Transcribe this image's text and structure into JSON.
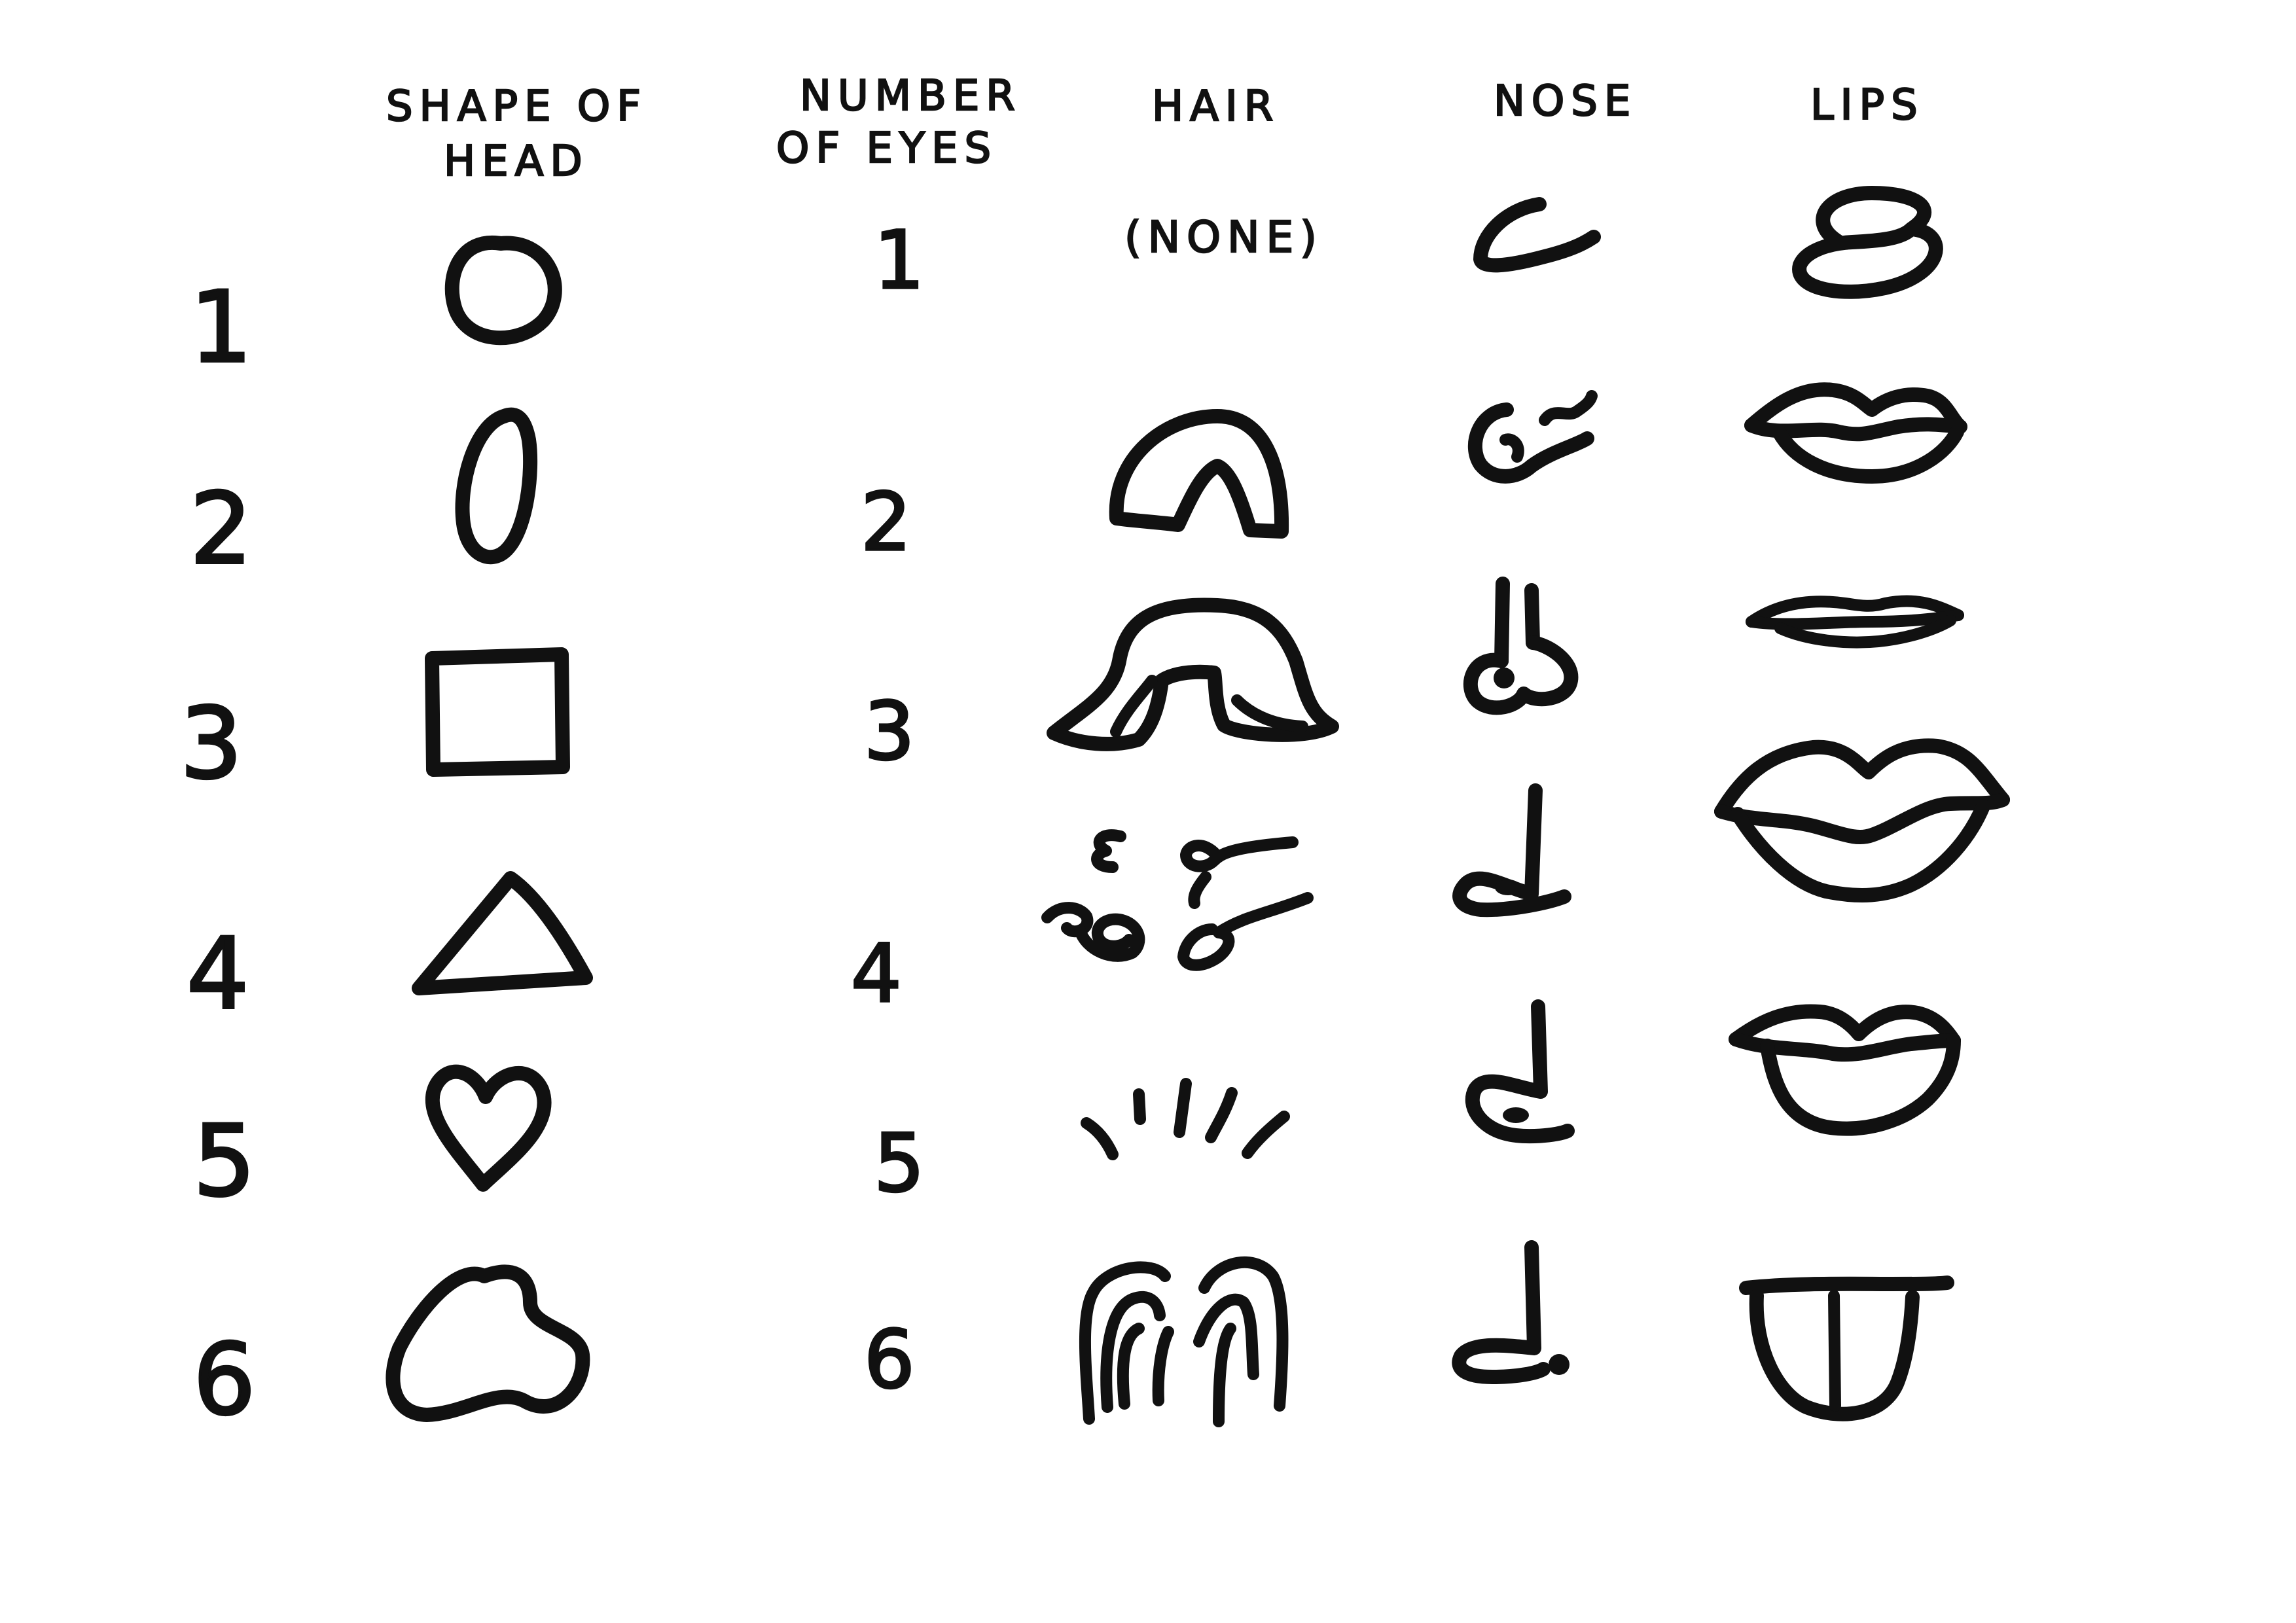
{
  "columns": {
    "head": [
      "SHAPE OF",
      "HEAD"
    ],
    "eyes": [
      "NUMBER",
      "OF EYES"
    ],
    "hair": "HAIR",
    "nose": "NOSE",
    "lips": "LIPS"
  },
  "rows": [
    "1",
    "2",
    "3",
    "4",
    "5",
    "6"
  ],
  "eye_counts": [
    "1",
    "2",
    "3",
    "4",
    "5",
    "6"
  ],
  "hair_none": "(NONE)",
  "colors": {
    "ink": "#111111",
    "paper": "#ffffff"
  }
}
